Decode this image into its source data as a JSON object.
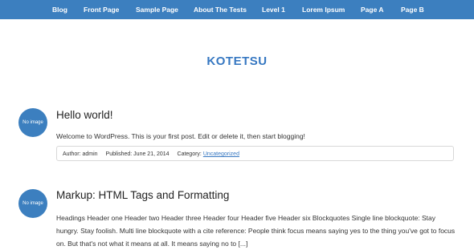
{
  "nav": {
    "items": [
      {
        "label": "Blog"
      },
      {
        "label": "Front Page"
      },
      {
        "label": "Sample Page"
      },
      {
        "label": "About The Tests"
      },
      {
        "label": "Level 1"
      },
      {
        "label": "Lorem Ipsum"
      },
      {
        "label": "Page A"
      },
      {
        "label": "Page B"
      }
    ]
  },
  "site": {
    "title": "KOTETSU"
  },
  "posts": [
    {
      "avatar_text": "No image",
      "title": "Hello world!",
      "excerpt": "Welcome to WordPress. This is your first post. Edit or delete it, then start blogging!",
      "author": "Author: admin",
      "published": "Published: June 21, 2014",
      "category_label": "Category:",
      "category_link": "Uncategorized"
    },
    {
      "avatar_text": "No image",
      "title": "Markup: HTML Tags and Formatting",
      "excerpt": "Headings Header one Header two Header three Header four Header five Header six Blockquotes Single line blockquote: Stay hungry. Stay foolish. Multi line blockquote with a cite reference: People think focus means saying yes to the thing you've got to focus on. But that's not what it means at all. It means saying no to [...]"
    }
  ]
}
